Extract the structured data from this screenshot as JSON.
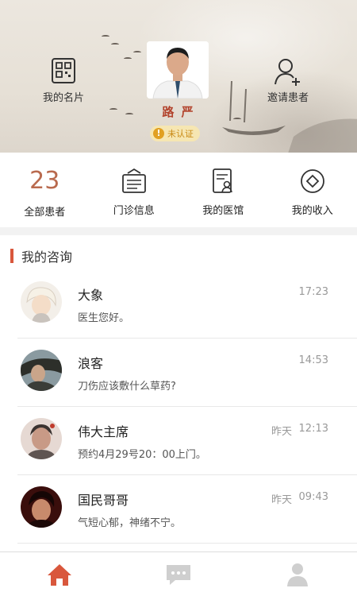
{
  "header": {
    "card_label": "我的名片",
    "invite_label": "邀请患者",
    "doctor_name": "路 严",
    "verify_status": "未认证",
    "verify_icon": "!"
  },
  "stats": {
    "patients_count": "23",
    "patients_label": "全部患者",
    "clinic_label": "门诊信息",
    "hospital_label": "我的医馆",
    "income_label": "我的收入"
  },
  "section": {
    "title": "我的咨询"
  },
  "consults": [
    {
      "name": "大象",
      "message": "医生您好。",
      "day": "",
      "time": "17:23"
    },
    {
      "name": "浪客",
      "message": "刀伤应该敷什么草药?",
      "day": "",
      "time": "14:53"
    },
    {
      "name": "伟大主席",
      "message": "预约4月29号20：00上门。",
      "day": "昨天",
      "time": "12:13"
    },
    {
      "name": "国民哥哥",
      "message": "气短心郁，神绪不宁。",
      "day": "昨天",
      "time": "09:43"
    }
  ],
  "colors": {
    "accent": "#d9573c",
    "number": "#b96a4e",
    "tab_active": "#d9573c",
    "tab_inactive": "#cfcfcf"
  },
  "tabbar": {
    "active": "home",
    "tabs": [
      "home-icon",
      "message-icon",
      "profile-icon"
    ]
  }
}
